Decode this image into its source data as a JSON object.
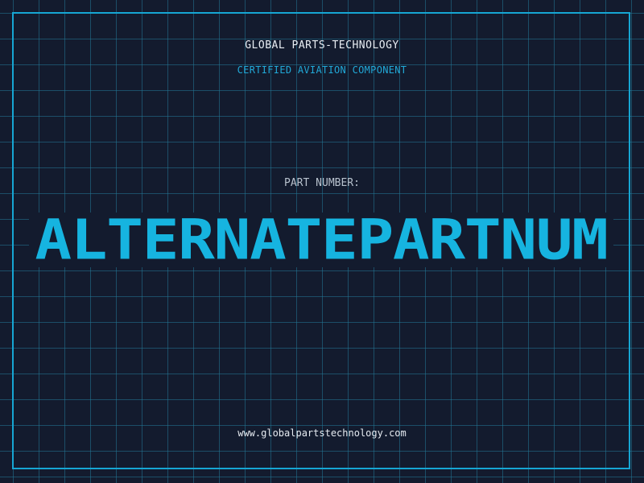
{
  "header": {
    "company": "GLOBAL PARTS-TECHNOLOGY",
    "tagline": "CERTIFIED AVIATION COMPONENT"
  },
  "part": {
    "label": "PART NUMBER:",
    "number": "ALTERNATEPARTNUM"
  },
  "footer": {
    "website": "www.globalpartstechnology.com"
  },
  "colors": {
    "background": "#131b2e",
    "grid": "#1f6f8a",
    "accent": "#16b4e0",
    "text": "#e8edf3"
  }
}
